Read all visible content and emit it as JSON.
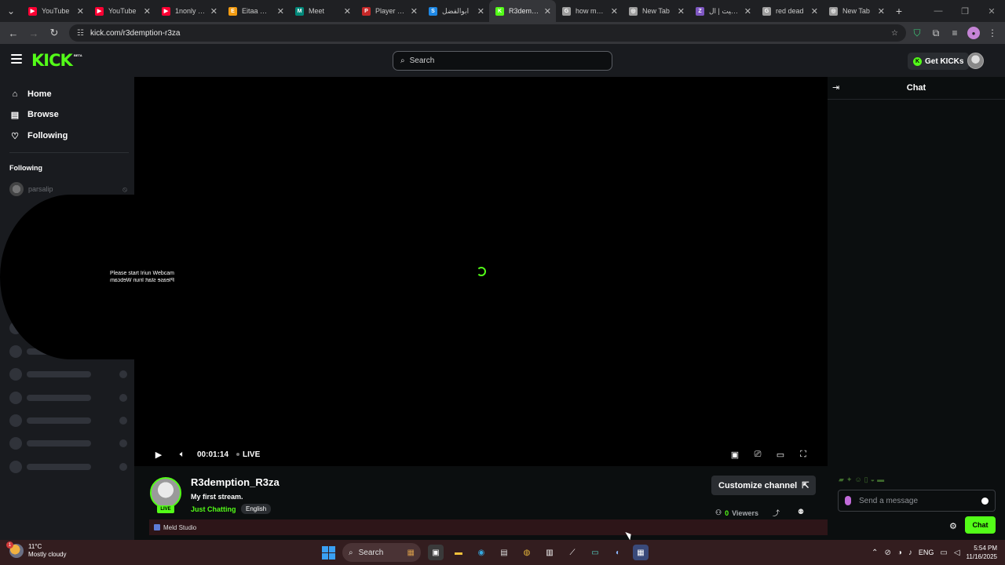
{
  "browser": {
    "tabs": [
      {
        "title": "YouTube",
        "favicon_color": "#ff0033",
        "favicon_glyph": "▶"
      },
      {
        "title": "YouTube",
        "favicon_color": "#ff0033",
        "favicon_glyph": "▶"
      },
      {
        "title": "1nonly - C",
        "favicon_color": "#ff0033",
        "favicon_glyph": "▶"
      },
      {
        "title": "Eitaa Web",
        "favicon_color": "#f39c12",
        "favicon_glyph": "E"
      },
      {
        "title": "Meet",
        "favicon_color": "#00897b",
        "favicon_glyph": "M"
      },
      {
        "title": "Player Pro",
        "favicon_color": "#c62828",
        "favicon_glyph": "P"
      },
      {
        "title": "ابوالفضل",
        "favicon_color": "#1e88e5",
        "favicon_glyph": "S"
      },
      {
        "title": "R3demptio",
        "favicon_color": "#53fc18",
        "favicon_glyph": "K"
      },
      {
        "title": "how many",
        "favicon_color": "#9e9e9e",
        "favicon_glyph": "G"
      },
      {
        "title": "New Tab",
        "favicon_color": "#9e9e9e",
        "favicon_glyph": "◎"
      },
      {
        "title": "زیمیت | ال",
        "favicon_color": "#7e57c2",
        "favicon_glyph": "Z"
      },
      {
        "title": "red dead",
        "favicon_color": "#9e9e9e",
        "favicon_glyph": "G"
      },
      {
        "title": "New Tab",
        "favicon_color": "#9e9e9e",
        "favicon_glyph": "◎"
      }
    ],
    "active_tab_index": 7,
    "url": "kick.com/r3demption-r3za"
  },
  "kick": {
    "logo": "KICK",
    "logo_badge": "BETA",
    "search_placeholder": "Search",
    "get_kicks": "Get KICKs",
    "nav": {
      "home": "Home",
      "browse": "Browse",
      "following": "Following"
    },
    "following_heading": "Following",
    "followed_channel": "parsalip",
    "overlay_text": "Please start Iriun Webcam",
    "player": {
      "time": "00:01:14",
      "live": "LIVE"
    },
    "channel": {
      "name": "R3demption_R3za",
      "stream_title": "My first stream.",
      "category": "Just Chatting",
      "language": "English",
      "live_badge": "LIVE",
      "customize": "Customize channel",
      "viewers_count": "0",
      "viewers_label": "Viewers"
    },
    "chat": {
      "title": "Chat",
      "placeholder": "Send a message",
      "send_button": "Chat"
    }
  },
  "meld": {
    "title": "Meld Studio"
  },
  "taskbar": {
    "weather_temp": "11°C",
    "weather_desc": "Mostly cloudy",
    "search": "Search",
    "lang": "ENG",
    "time": "5:54 PM",
    "date": "11/16/2025"
  },
  "colors": {
    "accent": "#53fc18",
    "background": "#0b0e0f",
    "panel": "#191b1f"
  }
}
